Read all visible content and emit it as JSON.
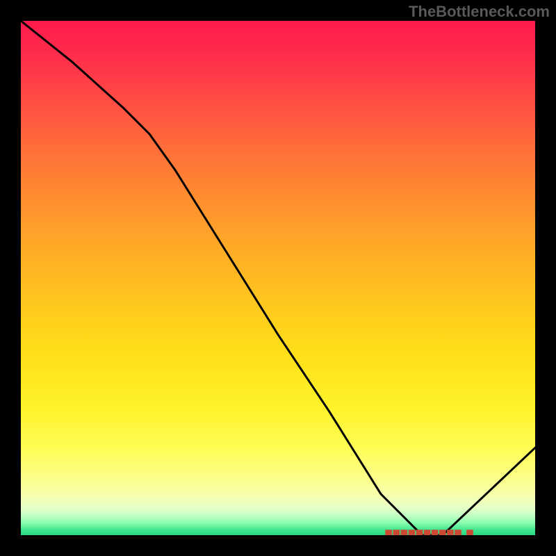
{
  "watermark": "TheBottleneck.com",
  "colors": {
    "page_bg": "#000000",
    "line": "#000000",
    "marker": "#cc4a33",
    "gradient_top": "#ff1a4d",
    "gradient_bottom": "#2bd884"
  },
  "chart_data": {
    "type": "line",
    "title": "",
    "xlabel": "",
    "ylabel": "",
    "xlim": [
      0,
      100
    ],
    "ylim": [
      0,
      100
    ],
    "grid": false,
    "note": "No axis ticks or labels are visible; x/y values are estimated as 0–100 relative coordinates, y=0 at bottom (green), y=100 at top (red).",
    "series": [
      {
        "name": "curve",
        "x": [
          0,
          10,
          20,
          25,
          30,
          40,
          50,
          60,
          70,
          78,
          82,
          100
        ],
        "y": [
          100,
          92,
          83,
          78,
          71,
          55,
          39,
          24,
          8,
          0,
          0,
          17
        ]
      }
    ],
    "markers": {
      "name": "bottom-markers",
      "shape": "square",
      "size": 1.3,
      "color": "#cc4a33",
      "points": [
        {
          "x": 71.5,
          "y": 0
        },
        {
          "x": 73.0,
          "y": 0
        },
        {
          "x": 74.5,
          "y": 0
        },
        {
          "x": 76.0,
          "y": 0
        },
        {
          "x": 77.5,
          "y": 0
        },
        {
          "x": 79.0,
          "y": 0
        },
        {
          "x": 80.5,
          "y": 0
        },
        {
          "x": 82.0,
          "y": 0
        },
        {
          "x": 83.5,
          "y": 0
        },
        {
          "x": 85.0,
          "y": 0
        },
        {
          "x": 87.3,
          "y": 0
        }
      ]
    }
  }
}
